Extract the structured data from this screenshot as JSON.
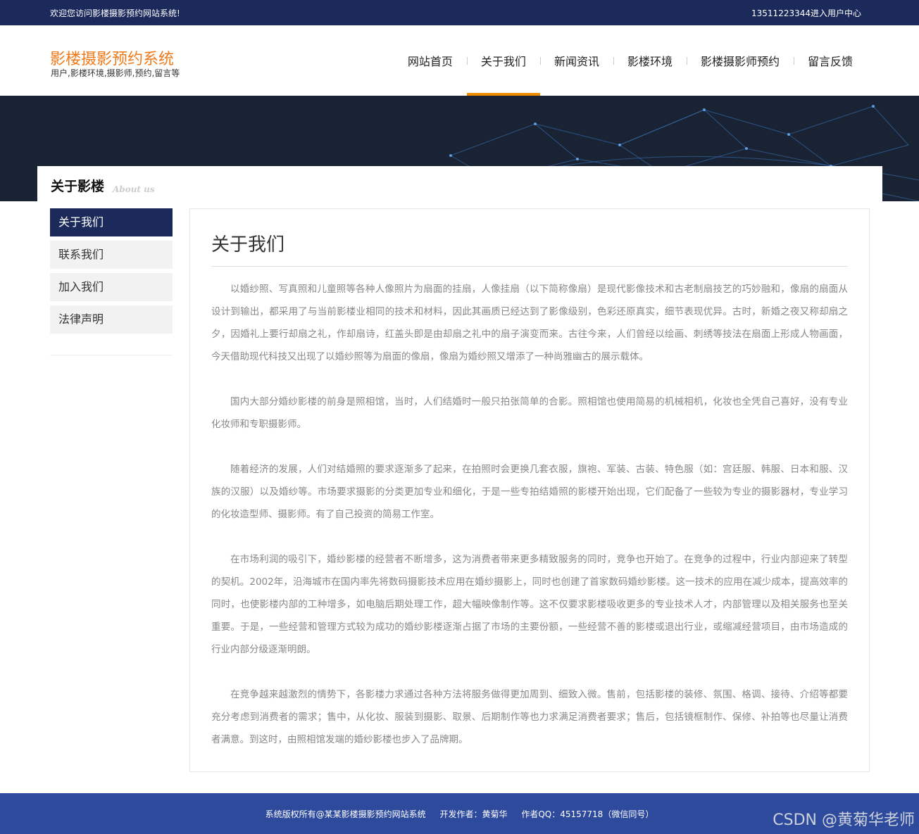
{
  "topbar": {
    "welcome": "欢迎您访问影楼摄影预约网站系统!",
    "user_center": "13511223344进入用户中心"
  },
  "header": {
    "site_title": "影楼摄影预约系统",
    "site_subtitle": "用户,影楼环境,摄影师,预约,留言等"
  },
  "nav": {
    "items": [
      {
        "label": "网站首页"
      },
      {
        "label": "关于我们"
      },
      {
        "label": "新闻资讯"
      },
      {
        "label": "影楼环境"
      },
      {
        "label": "影楼摄影师预约"
      },
      {
        "label": "留言反馈"
      }
    ],
    "active": "关于我们"
  },
  "section": {
    "title": "关于影楼",
    "title_en": "About us"
  },
  "sidebar": {
    "items": [
      {
        "label": "关于我们"
      },
      {
        "label": "联系我们"
      },
      {
        "label": "加入我们"
      },
      {
        "label": "法律声明"
      }
    ]
  },
  "content": {
    "heading": "关于我们",
    "paragraphs": [
      "以婚纱照、写真照和儿童照等各种人像照片为扇面的挂扇，人像挂扇（以下简称像扇）是现代影像技术和古老制扇技艺的巧妙融和，像扇的扇面从设计到输出，都采用了与当前影楼业相同的技术和材料，因此其画质已经达到了影像级别，色彩还原真实，细节表现优异。古时，新婚之夜又称却扇之夕，因婚礼上要行却扇之礼，作却扇诗，红盖头即是由却扇之礼中的扇子演变而来。古往今来，人们曾经以绘画、刺绣等技法在扇面上形成人物画面，今天借助现代科技又出现了以婚纱照等为扇面的像扇，像扇为婚纱照又增添了一种尚雅幽古的展示载体。",
      "国内大部分婚纱影楼的前身是照相馆，当时，人们结婚时一般只拍张简单的合影。照相馆也使用简易的机械相机，化妆也全凭自己喜好，没有专业化妆师和专职摄影师。",
      "随着经济的发展，人们对结婚照的要求逐渐多了起来，在拍照时会更换几套衣服，旗袍、军装、古装、特色服（如：宫廷服、韩服、日本和服、汉族的汉服）以及婚纱等。市场要求摄影的分类更加专业和细化，于是一些专拍结婚照的影楼开始出现，它们配备了一些较为专业的摄影器材，专业学习的化妆造型师、摄影师。有了自己投资的简易工作室。",
      "在市场利润的吸引下，婚纱影楼的经营者不断增多，这为消费者带来更多精致服务的同时，竞争也开始了。在竞争的过程中，行业内部迎来了转型的契机。2002年，沿海城市在国内率先将数码摄影技术应用在婚纱摄影上，同时也创建了首家数码婚纱影楼。这一技术的应用在减少成本，提高效率的同时，也使影楼内部的工种增多，如电脑后期处理工作，超大幅映像制作等。这不仅要求影楼吸收更多的专业技术人才，内部管理以及相关服务也至关重要。于是，一些经营和管理方式较为成功的婚纱影楼逐渐占据了市场的主要份额，一些经营不善的影楼或退出行业，或缩减经营项目，由市场造成的行业内部分级逐渐明朗。",
      "在竞争越来越激烈的情势下，各影楼力求通过各种方法将服务做得更加周到、细致入微。售前，包括影楼的装修、氛围、格调、接待、介绍等都要充分考虑到消费者的需求；售中，从化妆、服装到摄影、取景、后期制作等也力求满足消费者要求；售后，包括镜框制作、保修、补拍等也尽量让消费者满意。到这时，由照相馆发端的婚纱影楼也步入了品牌期。"
    ]
  },
  "footer": {
    "copyright": "系统版权所有@某某影楼摄影预约网站系统",
    "author": "开发作者：黄菊华",
    "qq": "作者QQ：45157718（微信同号）"
  },
  "watermark": "CSDN @黄菊华老师",
  "colors": {
    "topbar": "#1b2a5a",
    "brand_orange": "#f07a1a",
    "nav_active_bar": "#f08c00",
    "sidebar_active": "#1b2a5a",
    "footer": "#2e4a9c"
  }
}
